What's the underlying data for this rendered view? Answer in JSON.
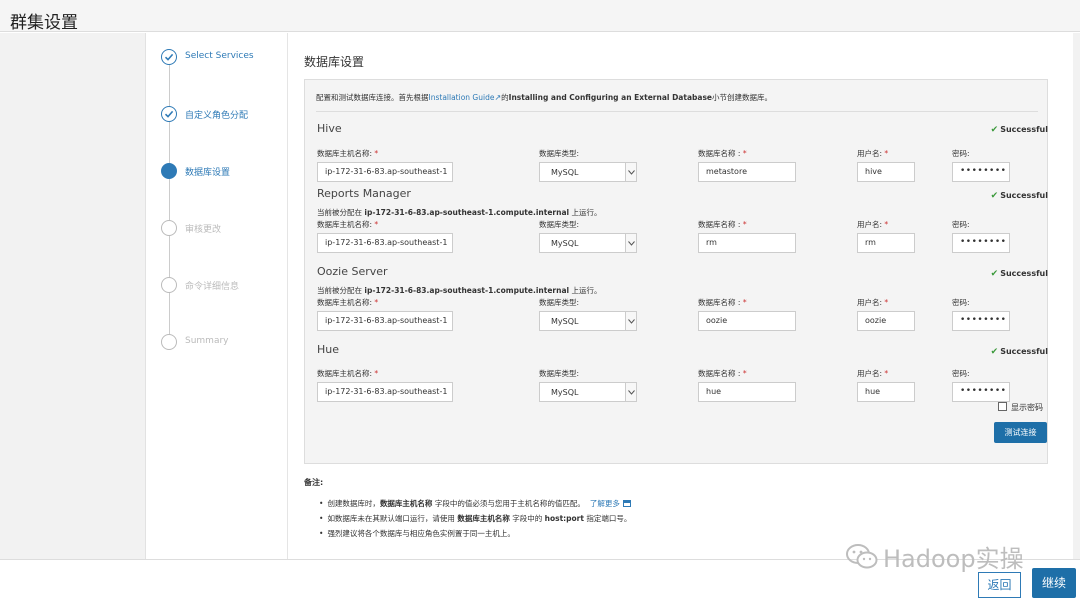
{
  "header": {
    "title": "群集设置"
  },
  "steps": [
    {
      "label": "Select Services",
      "state": "done"
    },
    {
      "label": "自定义角色分配",
      "state": "done"
    },
    {
      "label": "数据库设置",
      "state": "active"
    },
    {
      "label": "审核更改",
      "state": "pending"
    },
    {
      "label": "命令详细信息",
      "state": "pending"
    },
    {
      "label": "Summary",
      "state": "pending"
    }
  ],
  "main": {
    "title": "数据库设置",
    "intro": {
      "prefix": "配置和测试数据库连接。首先根据",
      "link": "Installation Guide",
      "middle": "的",
      "bold": "Installing and Configuring an External Database",
      "suffix": "小节创建数据库。"
    },
    "field_labels": {
      "host": "数据库主机名称:",
      "type": "数据库类型:",
      "dbname": "数据库名称 :",
      "user": "用户名:",
      "password": "密码:",
      "required": "*"
    },
    "assigned_text": {
      "prefix": "当前被分配在 ",
      "host": "ip-172-31-6-83.ap-southeast-1.compute.internal",
      "suffix": " 上运行。"
    },
    "status_success": "Successful",
    "sections": [
      {
        "name": "Hive",
        "host": "ip-172-31-6-83.ap-southeast-1",
        "type": "MySQL",
        "dbname": "metastore",
        "user": "hive",
        "password": "••••••••",
        "status": "Successful"
      },
      {
        "name": "Reports Manager",
        "host": "ip-172-31-6-83.ap-southeast-1",
        "type": "MySQL",
        "dbname": "rm",
        "user": "rm",
        "password": "••••••••",
        "status": "Successful"
      },
      {
        "name": "Oozie Server",
        "host": "ip-172-31-6-83.ap-southeast-1",
        "type": "MySQL",
        "dbname": "oozie",
        "user": "oozie",
        "password": "••••••••",
        "status": "Successful"
      },
      {
        "name": "Hue",
        "host": "ip-172-31-6-83.ap-southeast-1",
        "type": "MySQL",
        "dbname": "hue",
        "user": "hue",
        "password": "••••••••",
        "status": "Successful"
      }
    ],
    "show_password": "显示密码",
    "test_button": "测试连接"
  },
  "notes": {
    "title": "备注:",
    "item1_prefix": "创建数据库时，",
    "item1_bold": "数据库主机名称",
    "item1_suffix": " 字段中的值必须与您用于主机名称的值匹配。",
    "item1_link": "了解更多",
    "item2_prefix": "如数据库未在其默认端口运行，请使用 ",
    "item2_bold1": "数据库主机名称",
    "item2_middle": " 字段中的 ",
    "item2_bold2": "host:port",
    "item2_suffix": " 指定端口号。",
    "item3": "强烈建议将各个数据库与相应角色实例置于同一主机上。"
  },
  "footer": {
    "back": "返回",
    "next": "继续"
  },
  "watermark": "Hadoop实操",
  "colors": {
    "accent": "#2e7ab6",
    "primary_button": "#1e6fa8",
    "success": "#3c9a3c",
    "required": "#cc3333"
  }
}
